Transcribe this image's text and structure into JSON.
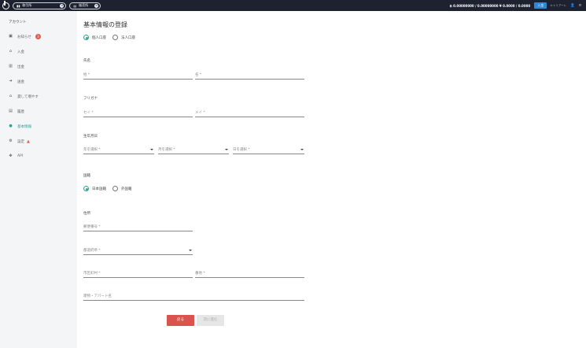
{
  "topbar": {
    "pill1": {
      "icon": "chart-icon",
      "label": "取引所"
    },
    "pill2": {
      "label": "販売所"
    },
    "balance": "₿ 0.00000000 / 0.00000000   ¥ 0.0000 / 0.0000",
    "deposit": "入金",
    "menu": "キャリアーレ"
  },
  "sidebar": {
    "title": "アカウント",
    "items": [
      {
        "label": "お知らせ",
        "icon": "message-icon",
        "badge": "3"
      },
      {
        "label": "入金",
        "icon": "bank-icon"
      },
      {
        "label": "出金",
        "icon": "withdraw-icon"
      },
      {
        "label": "送金",
        "icon": "send-icon"
      },
      {
        "label": "貸して増やす",
        "icon": "lend-icon"
      },
      {
        "label": "履歴",
        "icon": "history-icon"
      },
      {
        "label": "基本情報",
        "icon": "user-icon"
      },
      {
        "label": "設定",
        "icon": "settings-icon"
      },
      {
        "label": "API",
        "icon": "api-icon"
      }
    ]
  },
  "form": {
    "title": "基本情報の登録",
    "account_type": [
      "個人口座",
      "法人口座"
    ],
    "name_label": "氏名",
    "last_name": "姓 *",
    "first_name": "名 *",
    "kana_label": "フリガナ",
    "last_kana": "セイ *",
    "first_kana": "メイ *",
    "birth_label": "生年月日",
    "birth_year": "年を選択 *",
    "birth_month": "月を選択 *",
    "birth_day": "日を選択 *",
    "nationality_label": "国籍",
    "nationality": [
      "日本国籍",
      "外国籍"
    ],
    "address_label": "住所",
    "postal": "郵便番号 *",
    "prefecture": "都道府県 *",
    "city": "市区町村 *",
    "street": "番地 *",
    "building": "建物・アパート名",
    "back": "戻る",
    "next": "次に進む"
  }
}
